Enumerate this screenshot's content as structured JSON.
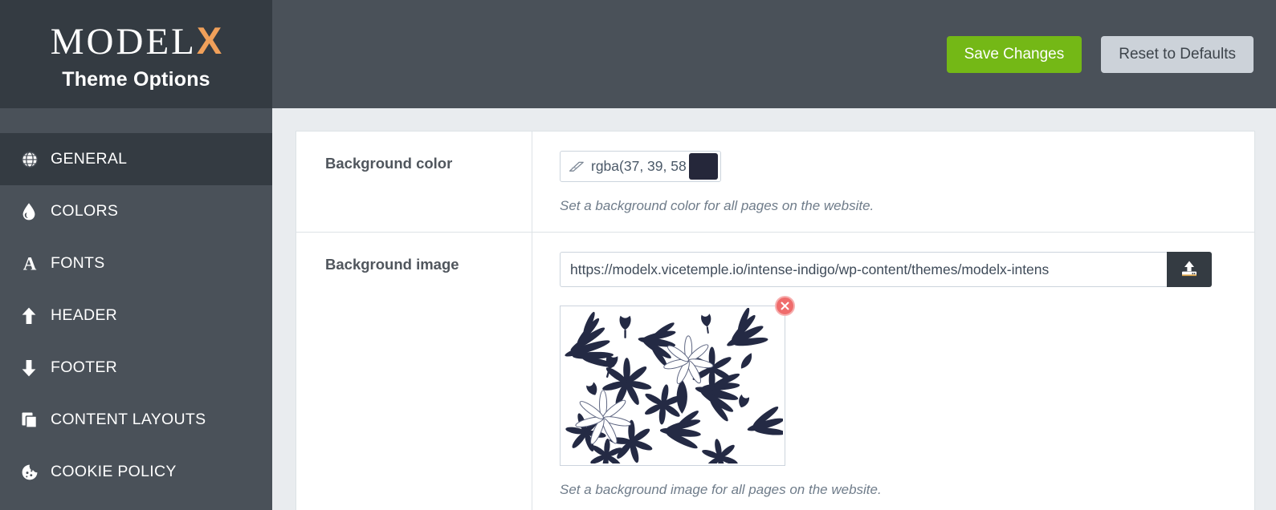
{
  "brand": {
    "logo_main": "MODEL",
    "logo_accent": "X",
    "subtitle": "Theme Options",
    "accent_color": "#f0a05a"
  },
  "topbar": {
    "save_label": "Save Changes",
    "reset_label": "Reset to Defaults",
    "save_color": "#74b816",
    "reset_color": "#ccd2d9"
  },
  "sidebar": {
    "items": [
      {
        "label": "GENERAL",
        "icon": "globe-icon",
        "active": true
      },
      {
        "label": "COLORS",
        "icon": "droplet-icon",
        "active": false
      },
      {
        "label": "FONTS",
        "icon": "letter-a-icon",
        "active": false
      },
      {
        "label": "HEADER",
        "icon": "arrow-up-icon",
        "active": false
      },
      {
        "label": "FOOTER",
        "icon": "arrow-down-icon",
        "active": false
      },
      {
        "label": "CONTENT LAYOUTS",
        "icon": "layers-icon",
        "active": false
      },
      {
        "label": "COOKIE POLICY",
        "icon": "cookie-icon",
        "active": false
      }
    ]
  },
  "fields": {
    "background_color": {
      "label": "Background color",
      "value": "rgba(37, 39, 58",
      "swatch_hex": "#25273a",
      "clear_icon": "eraser-icon",
      "help": "Set a background color for all pages on the website."
    },
    "background_image": {
      "label": "Background image",
      "value": "https://modelx.vicetemple.io/intense-indigo/wp-content/themes/modelx-intens",
      "upload_icon": "upload-icon",
      "remove_icon": "close-circle-icon",
      "preview_alt": "floral-pattern-preview",
      "help": "Set a background image for all pages on the website."
    }
  }
}
